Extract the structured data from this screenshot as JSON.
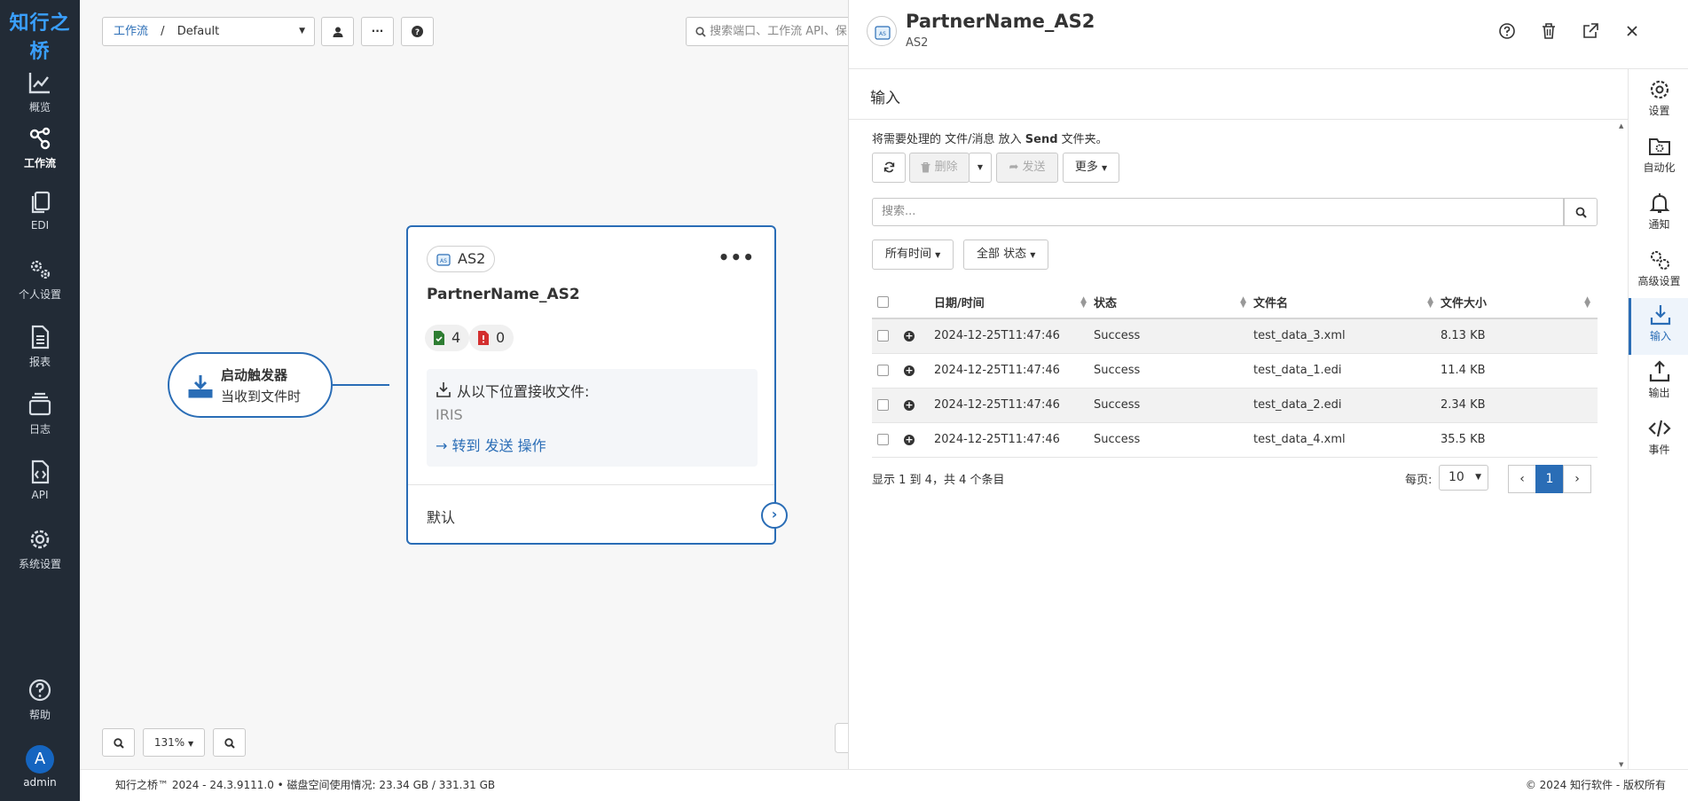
{
  "nav": {
    "logo": "知行之桥",
    "items": [
      {
        "label": "概览",
        "icon": "chart-line-icon"
      },
      {
        "label": "工作流",
        "icon": "share-nodes-icon"
      },
      {
        "label": "EDI",
        "icon": "copy-icon"
      },
      {
        "label": "个人设置",
        "icon": "gears-icon"
      },
      {
        "label": "报表",
        "icon": "file-lines-icon"
      },
      {
        "label": "日志",
        "icon": "layers-icon"
      },
      {
        "label": "API",
        "icon": "file-code-icon"
      },
      {
        "label": "系统设置",
        "icon": "gear-icon"
      },
      {
        "label": "帮助",
        "icon": "question-circle-icon"
      }
    ],
    "user": {
      "avatar": "A",
      "name": "admin"
    }
  },
  "canvas": {
    "breadcrumb": {
      "link": "工作流",
      "separator": "/",
      "current": "Default"
    },
    "search_placeholder": "搜索端口、工作流 API、保",
    "zoom": "131%",
    "trigger": {
      "title": "启动触发器",
      "subtitle": "当收到文件时"
    },
    "node": {
      "type": "AS2",
      "name": "PartnerName_AS2",
      "success_count": "4",
      "error_count": "0",
      "receive_label": "从以下位置接收文件:",
      "receive_value": "IRIS",
      "goto_label": "→ 转到 发送 操作",
      "default_label": "默认"
    }
  },
  "footer": {
    "left": "知行之桥™ 2024 - 24.3.9111.0  •  磁盘空间使用情况:  23.34 GB / 331.31 GB",
    "right": "© 2024 知行软件 - 版权所有"
  },
  "panel": {
    "title": "PartnerName_AS2",
    "subtitle": "AS2",
    "section": "输入",
    "hint_pre": "将需要处理的 文件/消息 放入 ",
    "hint_bold": "Send",
    "hint_post": " 文件夹。",
    "buttons": {
      "delete": "删除",
      "send": "发送",
      "more": "更多"
    },
    "search_placeholder": "搜索...",
    "filters": {
      "time": "所有时间",
      "status": "全部 状态"
    },
    "columns": {
      "datetime": "日期/时间",
      "status": "状态",
      "filename": "文件名",
      "size": "文件大小"
    },
    "rows": [
      {
        "datetime": "2024-12-25T11:47:46",
        "status": "Success",
        "filename": "test_data_3.xml",
        "size": "8.13 KB"
      },
      {
        "datetime": "2024-12-25T11:47:46",
        "status": "Success",
        "filename": "test_data_1.edi",
        "size": "11.4 KB"
      },
      {
        "datetime": "2024-12-25T11:47:46",
        "status": "Success",
        "filename": "test_data_2.edi",
        "size": "2.34 KB"
      },
      {
        "datetime": "2024-12-25T11:47:46",
        "status": "Success",
        "filename": "test_data_4.xml",
        "size": "35.5 KB"
      }
    ],
    "summary": "显示 1 到 4，共 4 个条目",
    "per_page_label": "每页:",
    "per_page": "10",
    "page": "1",
    "rail": [
      {
        "label": "设置",
        "icon": "gear-icon"
      },
      {
        "label": "自动化",
        "icon": "folder-gear-icon"
      },
      {
        "label": "通知",
        "icon": "bell-icon"
      },
      {
        "label": "高级设置",
        "icon": "gears-icon"
      },
      {
        "label": "输入",
        "icon": "download-icon"
      },
      {
        "label": "输出",
        "icon": "upload-icon"
      },
      {
        "label": "事件",
        "icon": "code-icon"
      }
    ]
  },
  "colors": {
    "accent": "#2a6db6",
    "nav_bg": "#222b36",
    "success": "#2e7d32",
    "error": "#d32f2f"
  }
}
